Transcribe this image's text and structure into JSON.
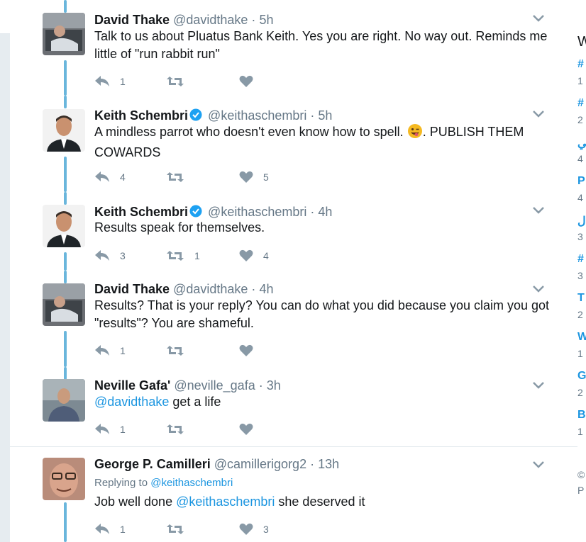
{
  "tweets": [
    {
      "name": "David Thake",
      "handle": "@davidthake",
      "time": "5h",
      "verified": false,
      "text": "Talk to us about Pluatus Bank Keith. Yes you are right. No way out. Reminds me little of \"run rabbit run\"",
      "replies": "1",
      "retweets": "",
      "likes": ""
    },
    {
      "name": "Keith Schembri",
      "handle": "@keithaschembri",
      "time": "5h",
      "verified": true,
      "text": "A mindless parrot who doesn't even know how to spell. ",
      "text_after_emoji": ". PUBLISH THEM COWARDS",
      "replies": "4",
      "retweets": "",
      "likes": "5"
    },
    {
      "name": "Keith Schembri",
      "handle": "@keithaschembri",
      "time": "4h",
      "verified": true,
      "text": "Results speak for themselves.",
      "replies": "3",
      "retweets": "1",
      "likes": "4"
    },
    {
      "name": "David Thake",
      "handle": "@davidthake",
      "time": "4h",
      "verified": false,
      "text": "Results? That is your reply? You can do what you did because you claim you got \"results\"? You are shameful.",
      "replies": "1",
      "retweets": "",
      "likes": ""
    },
    {
      "name": "Neville Gafa'",
      "handle": "@neville_gafa",
      "time": "3h",
      "verified": false,
      "mention": "@davidthake",
      "text": " get a life",
      "replies": "1",
      "retweets": "",
      "likes": ""
    },
    {
      "name": "George P. Camilleri",
      "handle": "@camillerigorg2",
      "time": "13h",
      "verified": false,
      "replying_to_label": "Replying to",
      "replying_to": "@keithaschembri",
      "text_before": "Job well done ",
      "mention": "@keithaschembri",
      "text_after": " she deserved it",
      "replies": "1",
      "retweets": "",
      "likes": "3"
    }
  ],
  "rail": {
    "letter": "W",
    "items": [
      "#",
      "#",
      "ﻲ",
      "P",
      "ﻝ",
      "#",
      "T",
      "W",
      "G",
      "B"
    ],
    "subs": [
      "1",
      "2",
      "4",
      "4",
      "3",
      "3",
      "2",
      "1",
      "2",
      "1"
    ],
    "footer": [
      "©",
      "P"
    ]
  },
  "sep": "·",
  "colors": {
    "accent": "#1b95e0",
    "thread": "#6ab6dc",
    "muted": "#657786"
  }
}
